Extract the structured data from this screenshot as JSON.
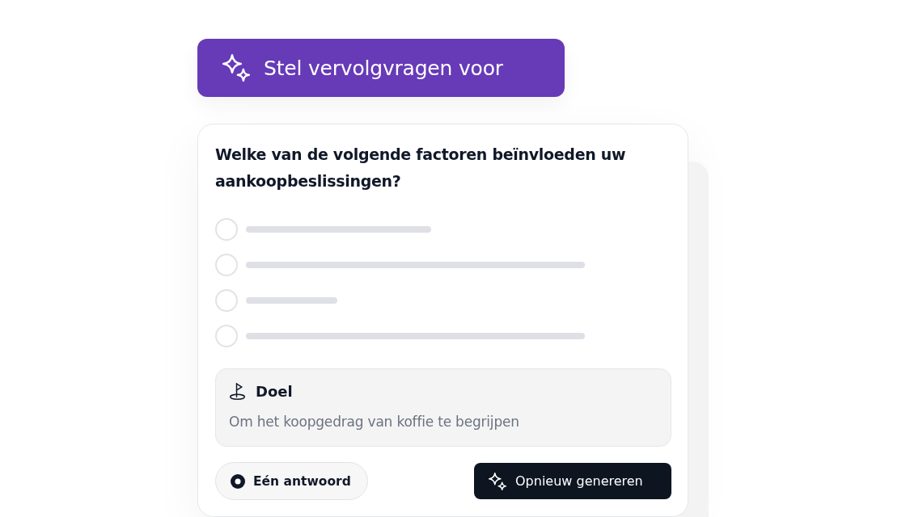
{
  "suggest_button": {
    "label": "Stel vervolgvragen voor"
  },
  "question_card": {
    "question": "Welke van de volgende factoren beïnvloeden uw aankoopbeslissingen?",
    "options": [
      {
        "selected": false
      },
      {
        "selected": false
      },
      {
        "selected": false
      },
      {
        "selected": false
      }
    ],
    "goal": {
      "title": "Doel",
      "text": "Om het koopgedrag van koffie te begrijpen"
    },
    "answer_type": {
      "label": "Eén antwoord"
    },
    "regenerate_button": {
      "label": "Opnieuw genereren"
    }
  }
}
